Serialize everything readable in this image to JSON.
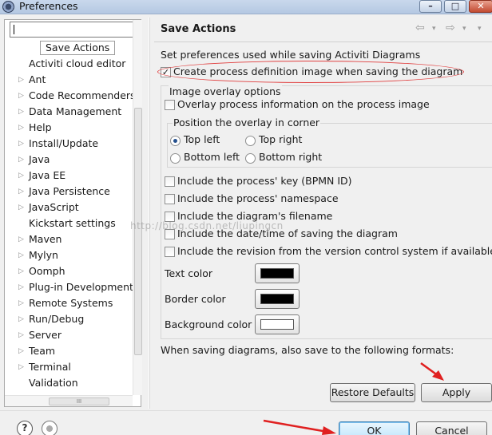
{
  "window": {
    "title": "Preferences",
    "min": "–",
    "max": "□",
    "close": "✕"
  },
  "filter": {
    "value": ""
  },
  "tree": {
    "items": [
      {
        "label": "Save Actions",
        "selected": true,
        "expandable": false
      },
      {
        "label": "Activiti cloud editor",
        "expandable": false
      },
      {
        "label": "Ant",
        "expandable": true
      },
      {
        "label": "Code Recommenders",
        "expandable": true
      },
      {
        "label": "Data Management",
        "expandable": true
      },
      {
        "label": "Help",
        "expandable": true
      },
      {
        "label": "Install/Update",
        "expandable": true
      },
      {
        "label": "Java",
        "expandable": true
      },
      {
        "label": "Java EE",
        "expandable": true
      },
      {
        "label": "Java Persistence",
        "expandable": true
      },
      {
        "label": "JavaScript",
        "expandable": true
      },
      {
        "label": "Kickstart settings",
        "expandable": false
      },
      {
        "label": "Maven",
        "expandable": true
      },
      {
        "label": "Mylyn",
        "expandable": true
      },
      {
        "label": "Oomph",
        "expandable": true
      },
      {
        "label": "Plug-in Development",
        "expandable": true
      },
      {
        "label": "Remote Systems",
        "expandable": true
      },
      {
        "label": "Run/Debug",
        "expandable": true
      },
      {
        "label": "Server",
        "expandable": true
      },
      {
        "label": "Team",
        "expandable": true
      },
      {
        "label": "Terminal",
        "expandable": true
      },
      {
        "label": "Validation",
        "expandable": false
      }
    ],
    "hscroll_grip": "III"
  },
  "page": {
    "title": "Save Actions",
    "nav": {
      "back": "⇦",
      "forward": "⇨",
      "dropdown": "▾"
    },
    "description": "Set preferences used while saving Activiti Diagrams",
    "create_image": {
      "label": "Create process definition image when saving the diagram",
      "checked": true
    },
    "image_overlay": {
      "title": "Image overlay options",
      "overlay_info": {
        "label": "Overlay process information on the process image",
        "checked": false
      },
      "position_title": "Position the overlay in corner",
      "positions": [
        {
          "label": "Top left",
          "selected": true
        },
        {
          "label": "Top right",
          "selected": false
        },
        {
          "label": "Bottom left",
          "selected": false
        },
        {
          "label": "Bottom right",
          "selected": false
        }
      ],
      "include_key": {
        "label": "Include the process' key (BPMN ID)",
        "checked": false
      },
      "include_namespace": {
        "label": "Include the process' namespace",
        "checked": false
      },
      "include_filename": {
        "label": "Include the diagram's filename",
        "checked": false
      },
      "include_datetime": {
        "label": "Include the date/time of saving the diagram",
        "checked": false
      },
      "include_revision": {
        "label": "Include the revision from the version control system if available",
        "checked": false
      },
      "text_color": {
        "label": "Text color",
        "value": "#000000"
      },
      "border_color": {
        "label": "Border color",
        "value": "#000000"
      },
      "background_color": {
        "label": "Background color",
        "value": "#ffffff"
      }
    },
    "formats_text": "When saving diagrams, also save to the following formats:"
  },
  "buttons": {
    "restore_defaults": "Restore Defaults",
    "apply": "Apply",
    "ok": "OK",
    "cancel": "Cancel",
    "help": "?"
  },
  "watermark": "http://blog.csdn.net/liupingcn",
  "colors": {
    "annotation_red": "#e02020",
    "accent_blue": "#25508e"
  }
}
